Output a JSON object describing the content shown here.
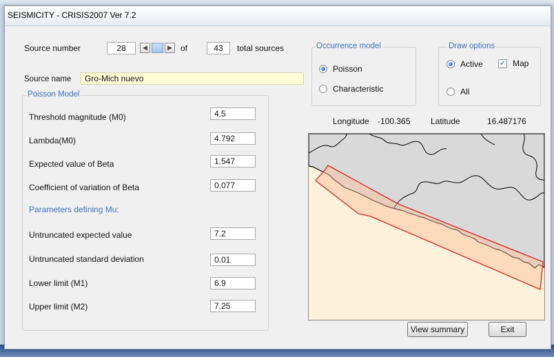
{
  "window": {
    "title": "SEISMICITY - CRISIS2007 Ver 7.2"
  },
  "source": {
    "number_label": "Source number",
    "number_value": "28",
    "of_label": "of",
    "total_value": "43",
    "total_label": "total sources",
    "name_label": "Source name",
    "name_value": "Gro-Mich nuevo"
  },
  "poisson_model": {
    "group_title": "Poisson Model",
    "fields": [
      {
        "label": "Threshold magnitude (M0)",
        "value": "4.5"
      },
      {
        "label": "Lambda(M0)",
        "value": "4.792"
      },
      {
        "label": "Expected value of Beta",
        "value": "1.547"
      },
      {
        "label": "Coefficient of variation of Beta",
        "value": "0.077"
      }
    ],
    "mu_heading": "Parameters defining Mu:",
    "mu_fields": [
      {
        "label": "Untruncated expected value",
        "value": "7.2"
      },
      {
        "label": "Untruncated standard deviation",
        "value": "0.01"
      },
      {
        "label": "Lower limit (M1)",
        "value": "6.9"
      },
      {
        "label": "Upper limit (M2)",
        "value": "7.25"
      }
    ]
  },
  "occurrence_model": {
    "group_title": "Occurrence model",
    "options": [
      {
        "label": "Poisson",
        "selected": true
      },
      {
        "label": "Characteristic",
        "selected": false
      }
    ]
  },
  "draw_options": {
    "group_title": "Draw options",
    "options": [
      {
        "label": "Active",
        "selected": true
      },
      {
        "label": "All",
        "selected": false
      }
    ],
    "map_checkbox": {
      "label": "Map",
      "checked": true
    }
  },
  "coords": {
    "longitude_label": "Longitude",
    "longitude_value": "-100.365",
    "latitude_label": "Latitude",
    "latitude_value": "16.487176"
  },
  "buttons": {
    "view_summary": "View summary",
    "exit": "Exit"
  },
  "colors": {
    "accent": "#3f6fc0",
    "source_outline": "#e02020",
    "land": "#d9d9d9",
    "ocean": "#fcf1d9"
  }
}
